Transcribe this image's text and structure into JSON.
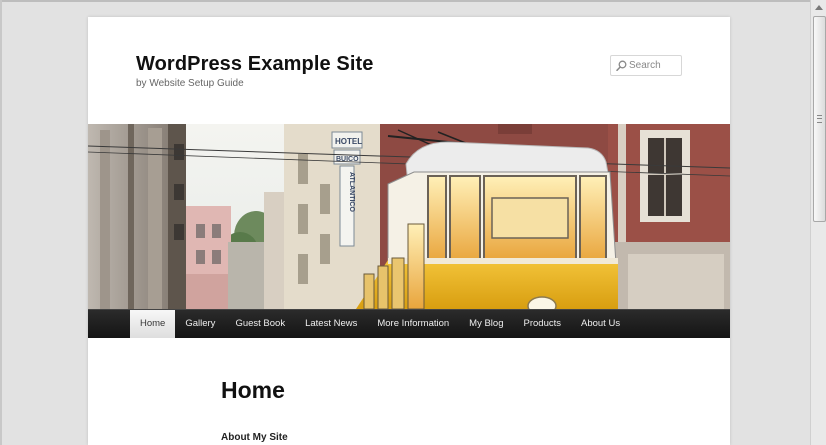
{
  "site": {
    "title": "WordPress Example Site",
    "description": "by Website Setup Guide"
  },
  "search": {
    "placeholder": "Search",
    "icon": "search-icon"
  },
  "header_image": {
    "tram_color": "#e8b51e",
    "sign_text": [
      "HOTEL",
      "BUICO",
      "ATLANTICO"
    ]
  },
  "nav": {
    "items": [
      {
        "label": "Home",
        "active": true
      },
      {
        "label": "Gallery"
      },
      {
        "label": "Guest Book"
      },
      {
        "label": "Latest News"
      },
      {
        "label": "More Information"
      },
      {
        "label": "My Blog"
      },
      {
        "label": "Products"
      },
      {
        "label": "About Us"
      }
    ]
  },
  "content": {
    "title": "Home",
    "subheading": "About My Site"
  },
  "colors": {
    "nav_background": "#1b1b1b",
    "page_background": "#ffffff",
    "outer_background": "#e2e2e2"
  }
}
